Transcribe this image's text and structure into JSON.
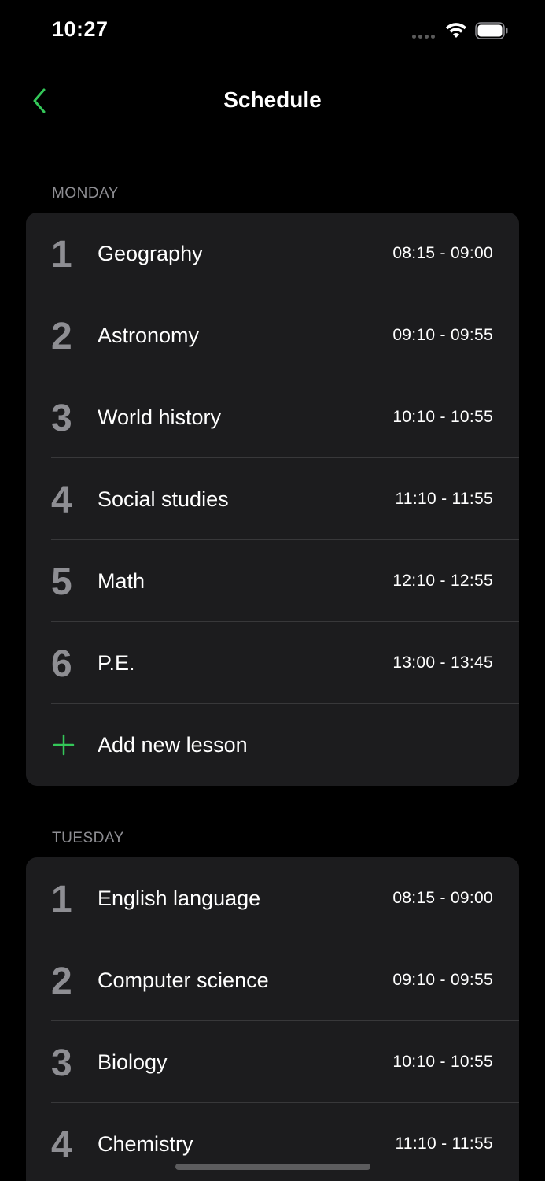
{
  "status_bar": {
    "time": "10:27"
  },
  "nav": {
    "title": "Schedule",
    "back_icon": "chevron-left-icon",
    "accent_color": "#34c759"
  },
  "sections": [
    {
      "day": "MONDAY",
      "lessons": [
        {
          "num": "1",
          "name": "Geography",
          "time": "08:15 - 09:00"
        },
        {
          "num": "2",
          "name": "Astronomy",
          "time": "09:10 - 09:55"
        },
        {
          "num": "3",
          "name": "World history",
          "time": "10:10 - 10:55"
        },
        {
          "num": "4",
          "name": "Social studies",
          "time": "11:10 - 11:55"
        },
        {
          "num": "5",
          "name": "Math",
          "time": "12:10 - 12:55"
        },
        {
          "num": "6",
          "name": "P.E.",
          "time": "13:00 - 13:45"
        }
      ],
      "add_label": "Add new lesson"
    },
    {
      "day": "TUESDAY",
      "lessons": [
        {
          "num": "1",
          "name": "English language",
          "time": "08:15 - 09:00"
        },
        {
          "num": "2",
          "name": "Computer science",
          "time": "09:10 - 09:55"
        },
        {
          "num": "3",
          "name": "Biology",
          "time": "10:10 - 10:55"
        },
        {
          "num": "4",
          "name": "Chemistry",
          "time": "11:10 - 11:55"
        }
      ]
    }
  ]
}
